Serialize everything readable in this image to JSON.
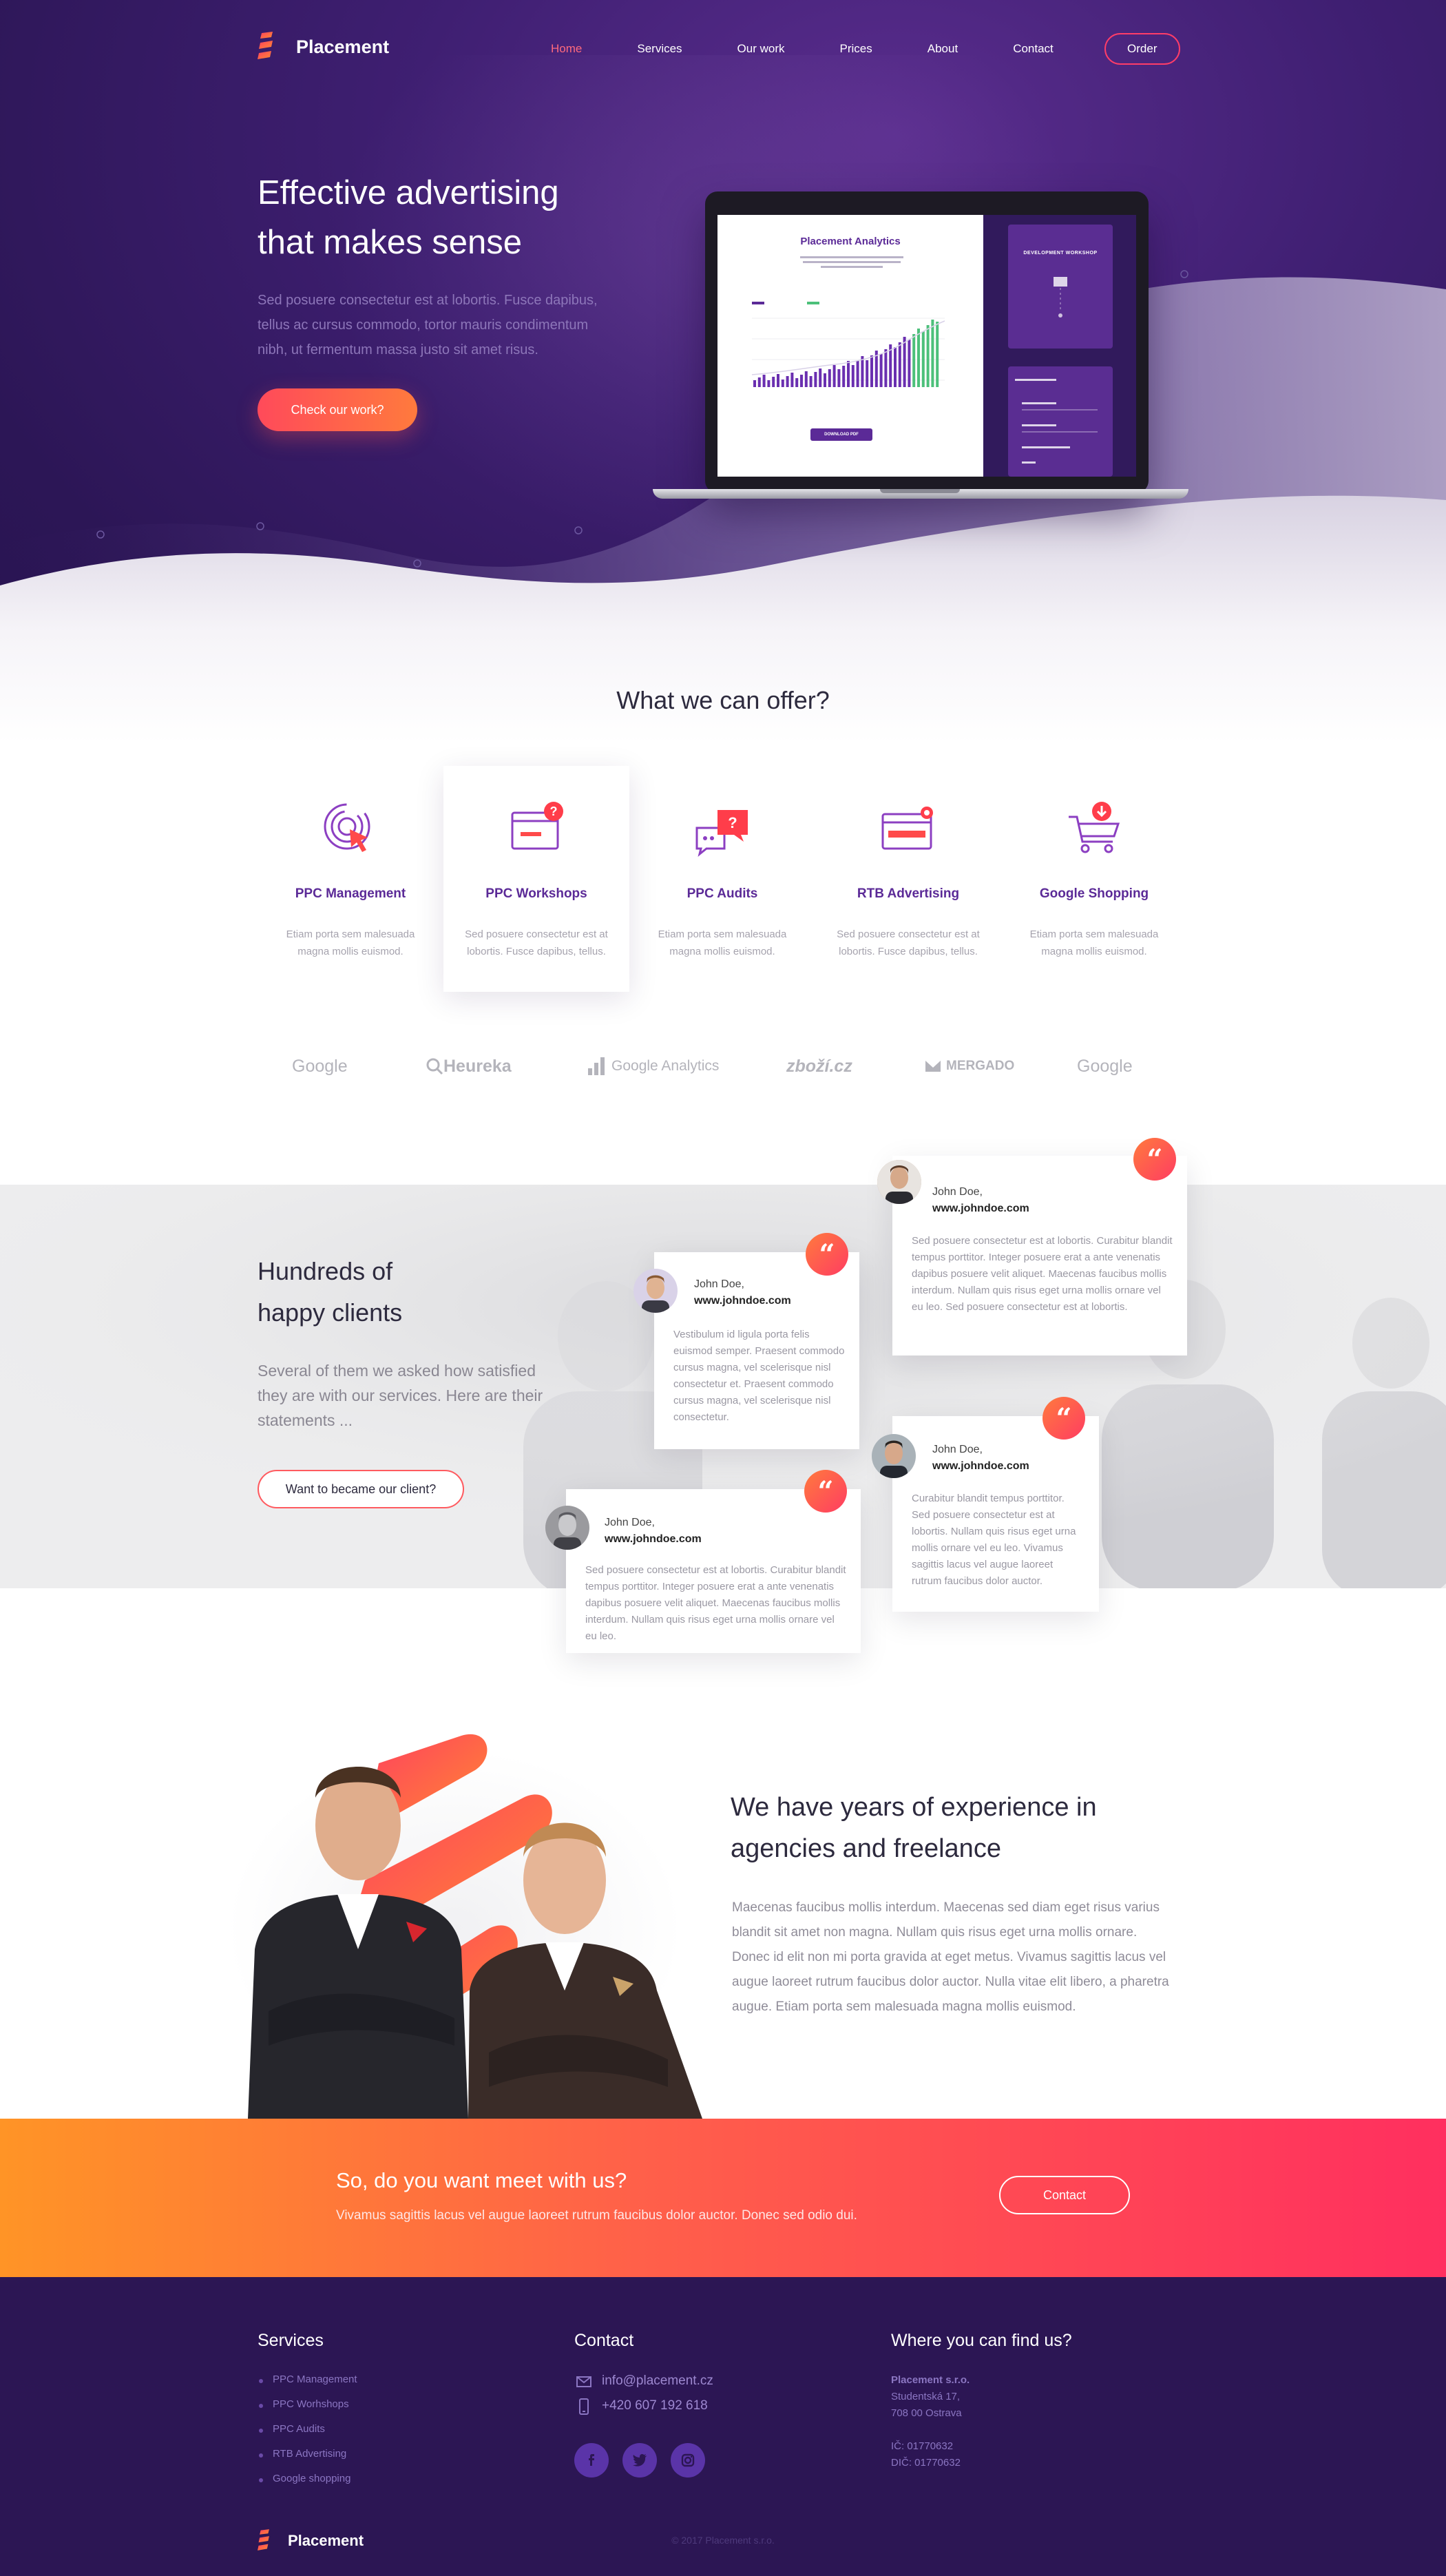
{
  "brand": {
    "name": "Placement"
  },
  "nav": {
    "items": [
      {
        "label": "Home"
      },
      {
        "label": "Services"
      },
      {
        "label": "Our work"
      },
      {
        "label": "Prices"
      },
      {
        "label": "About"
      },
      {
        "label": "Contact"
      }
    ],
    "order_label": "Order"
  },
  "hero": {
    "title_line1": "Effective advertising",
    "title_line2": "that makes sense",
    "text": "Sed posuere consectetur est at lobortis. Fusce dapibus, tellus ac cursus commodo, tortor mauris condimentum nibh, ut fermentum massa justo sit amet risus.",
    "cta_label": "Check our work?",
    "screen": {
      "title": "Placement Analytics",
      "right_card_title": "DEVELOPMENT WORKSHOP",
      "button_label": "DOWNLOAD PDF"
    }
  },
  "offer": {
    "title": "What we can offer?",
    "items": [
      {
        "name": "PPC Management",
        "desc": "Etiam porta sem malesuada magna mollis euismod."
      },
      {
        "name": "PPC Workshops",
        "desc": "Sed posuere consectetur est at lobortis. Fusce dapibus, tellus."
      },
      {
        "name": "PPC Audits",
        "desc": "Etiam porta sem malesuada magna mollis euismod."
      },
      {
        "name": "RTB Advertising",
        "desc": "Sed posuere consectetur est at lobortis. Fusce dapibus, tellus."
      },
      {
        "name": "Google Shopping",
        "desc": "Etiam porta sem malesuada magna mollis euismod."
      }
    ]
  },
  "partners": [
    "Google",
    "Heureka",
    "Google Analytics",
    "zboží.cz",
    "MERGADO",
    "Google"
  ],
  "clients": {
    "title_line1": "Hundreds of",
    "title_line2": "happy clients",
    "text": "Several of them we asked how satisfied they are with our services. Here are their statements ...",
    "button_label": "Want to became our client?",
    "testimonials": [
      {
        "name": "John Doe,",
        "site": "www.johndoe.com",
        "body": "Sed posuere consectetur est at lobortis. Curabitur blandit tempus porttitor. Integer posuere erat a ante venenatis dapibus posuere velit aliquet. Maecenas faucibus mollis interdum. Nullam quis risus eget urna mollis ornare vel eu leo. Sed posuere consectetur est at lobortis."
      },
      {
        "name": "John Doe,",
        "site": "www.johndoe.com",
        "body": "Vestibulum id ligula porta felis euismod semper. Praesent commodo cursus magna, vel scelerisque nisl consectetur et. Praesent commodo cursus magna, vel scelerisque nisl consectetur."
      },
      {
        "name": "John Doe,",
        "site": "www.johndoe.com",
        "body": "Curabitur blandit tempus porttitor. Sed posuere consectetur est at lobortis. Nullam quis risus eget urna mollis ornare vel eu leo. Vivamus sagittis lacus vel augue laoreet rutrum faucibus dolor auctor."
      },
      {
        "name": "John Doe,",
        "site": "www.johndoe.com",
        "body": "Sed posuere consectetur est at lobortis. Curabitur blandit tempus porttitor. Integer posuere erat a ante venenatis dapibus posuere velit aliquet. Maecenas faucibus mollis interdum. Nullam quis risus eget urna mollis ornare vel eu leo."
      }
    ]
  },
  "experience": {
    "title_line1": "We have years of experience in",
    "title_line2": "agencies and freelance",
    "text": "Maecenas faucibus mollis interdum. Maecenas sed diam eget risus varius blandit sit amet non magna. Nullam quis risus eget urna mollis ornare. Donec id elit non mi porta gravida at eget metus. Vivamus sagittis lacus vel augue laoreet rutrum faucibus dolor auctor. Nulla vitae elit libero, a pharetra augue. Etiam porta sem malesuada magna mollis euismod."
  },
  "cta": {
    "title": "So, do you want meet with us?",
    "text": "Vivamus sagittis lacus vel augue laoreet rutrum faucibus dolor auctor. Donec sed odio dui.",
    "button_label": "Contact"
  },
  "footer": {
    "services_title": "Services",
    "services": [
      "PPC Management",
      "PPC Worhshops",
      "PPC Audits",
      "RTB Advertising",
      "Google shopping"
    ],
    "contact_title": "Contact",
    "email": "info@placement.cz",
    "phone": "+420 607 192 618",
    "social": [
      "facebook-icon",
      "twitter-icon",
      "instagram-icon"
    ],
    "where_title": "Where you can find us?",
    "company": "Placement s.r.o.",
    "street": "Studentská 17,",
    "city": "708 00 Ostrava",
    "ico": "IČ: 01770632",
    "dic": "DIČ: 01770632",
    "brand": "Placement",
    "copyright": "© 2017 Placement s.r.o."
  },
  "colors": {
    "hero_purple": "#3f1f72",
    "footer_purple": "#2c1654",
    "accent_red": "#ff3d62",
    "accent_orange": "#ff9426",
    "brand_purple": "#5b2a97"
  }
}
